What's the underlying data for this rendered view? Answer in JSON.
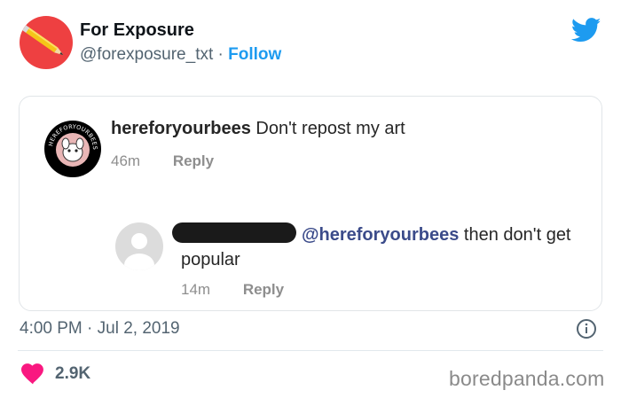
{
  "tweet": {
    "author_name": "For Exposure",
    "handle": "@forexposure_txt",
    "separator": "·",
    "follow_label": "Follow",
    "timestamp": "4:00 PM · Jul 2, 2019",
    "likes": "2.9K",
    "avatar_icon": "pencil-icon",
    "brand_icon": "twitter-bird-icon",
    "colors": {
      "accent": "#1d9bf0",
      "like": "#f91880",
      "avatar_bg": "#ee4041"
    }
  },
  "card": {
    "comment1": {
      "username": "hereforyourbees",
      "text": "Don't repost my art",
      "time": "46m",
      "reply_label": "Reply",
      "avatar_text": "HEREFORYOURBEES"
    },
    "comment2": {
      "mention": "@hereforyourbees",
      "text_line1": "then don't get",
      "text_line2": "popular",
      "time": "14m",
      "reply_label": "Reply"
    }
  },
  "watermark": "boredpanda.com"
}
